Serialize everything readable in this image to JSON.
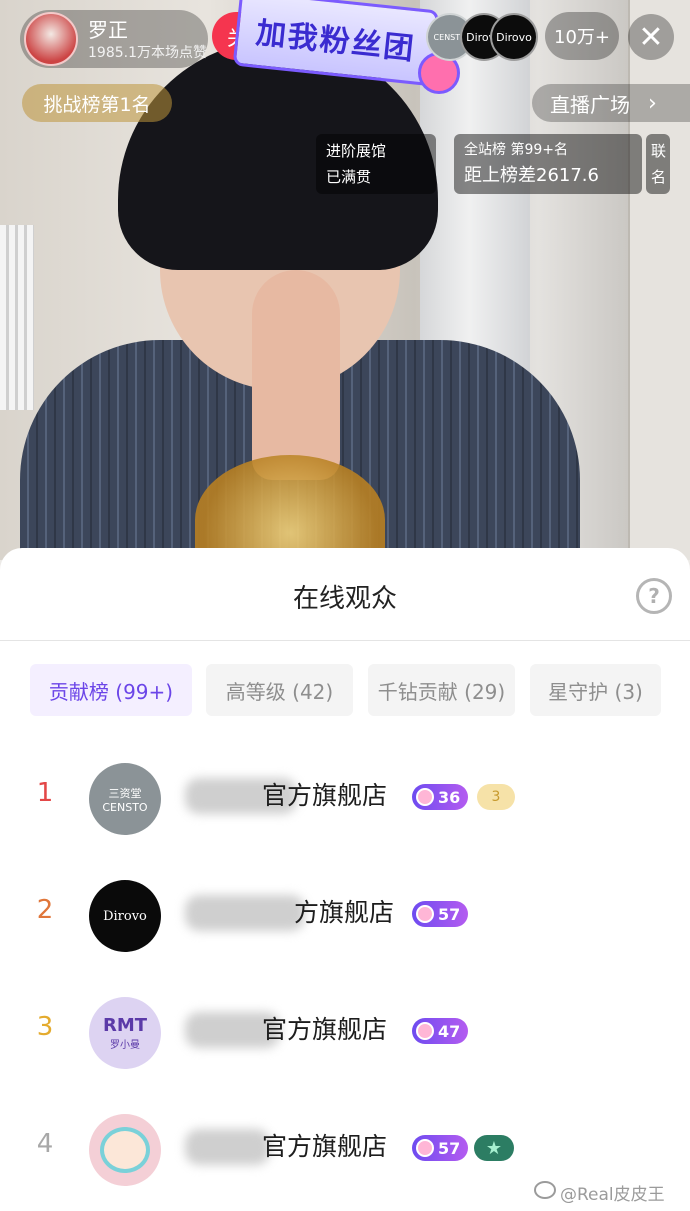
{
  "header": {
    "host_name": "罗正",
    "host_likes": "1985.1万本场点赞",
    "follow_label": "关注",
    "banner_text": "加我粉丝团",
    "viewer_count": "10万+",
    "close_icon": "close-icon",
    "challenge_label": "挑战榜第1名",
    "plaza_label": "直播广场",
    "viewer_avatars": [
      "CENSTO",
      "Dirovo",
      "Dirovo"
    ]
  },
  "info": {
    "exhibit_line1": "进阶展馆",
    "exhibit_line2": "已满贯",
    "rank_line1": "全站榜 第99+名",
    "rank_line2": "距上榜差2617.6",
    "link_label": "联名"
  },
  "sheet": {
    "title": "在线观众",
    "help_icon": "?",
    "tabs": [
      {
        "label": "贡献榜 (99+)",
        "active": true
      },
      {
        "label": "高等级 (42)",
        "active": false
      },
      {
        "label": "千钻贡献 (29)",
        "active": false
      },
      {
        "label": "星守护 (3)",
        "active": false
      }
    ],
    "rows": [
      {
        "rank": "1",
        "avatar_text": "三资堂",
        "avatar_sub": "CENSTO",
        "name": "官方旗舰店",
        "level": "36",
        "extra_badge": "3"
      },
      {
        "rank": "2",
        "avatar_text": "Dirovo",
        "name": "方旗舰店",
        "level": "57"
      },
      {
        "rank": "3",
        "avatar_text": "RMT",
        "avatar_sub": "罗小曼",
        "name": "官方旗舰店",
        "level": "47"
      },
      {
        "rank": "4",
        "name": "官方旗舰店",
        "level": "57",
        "extra_badge": "★"
      }
    ]
  },
  "watermark": "@Real皮皮王",
  "colors": {
    "accent": "#6b45e8",
    "follow": "#f5354f",
    "rank1": "#e34747",
    "rank2": "#e0763a",
    "rank3": "#e4ab2e"
  }
}
